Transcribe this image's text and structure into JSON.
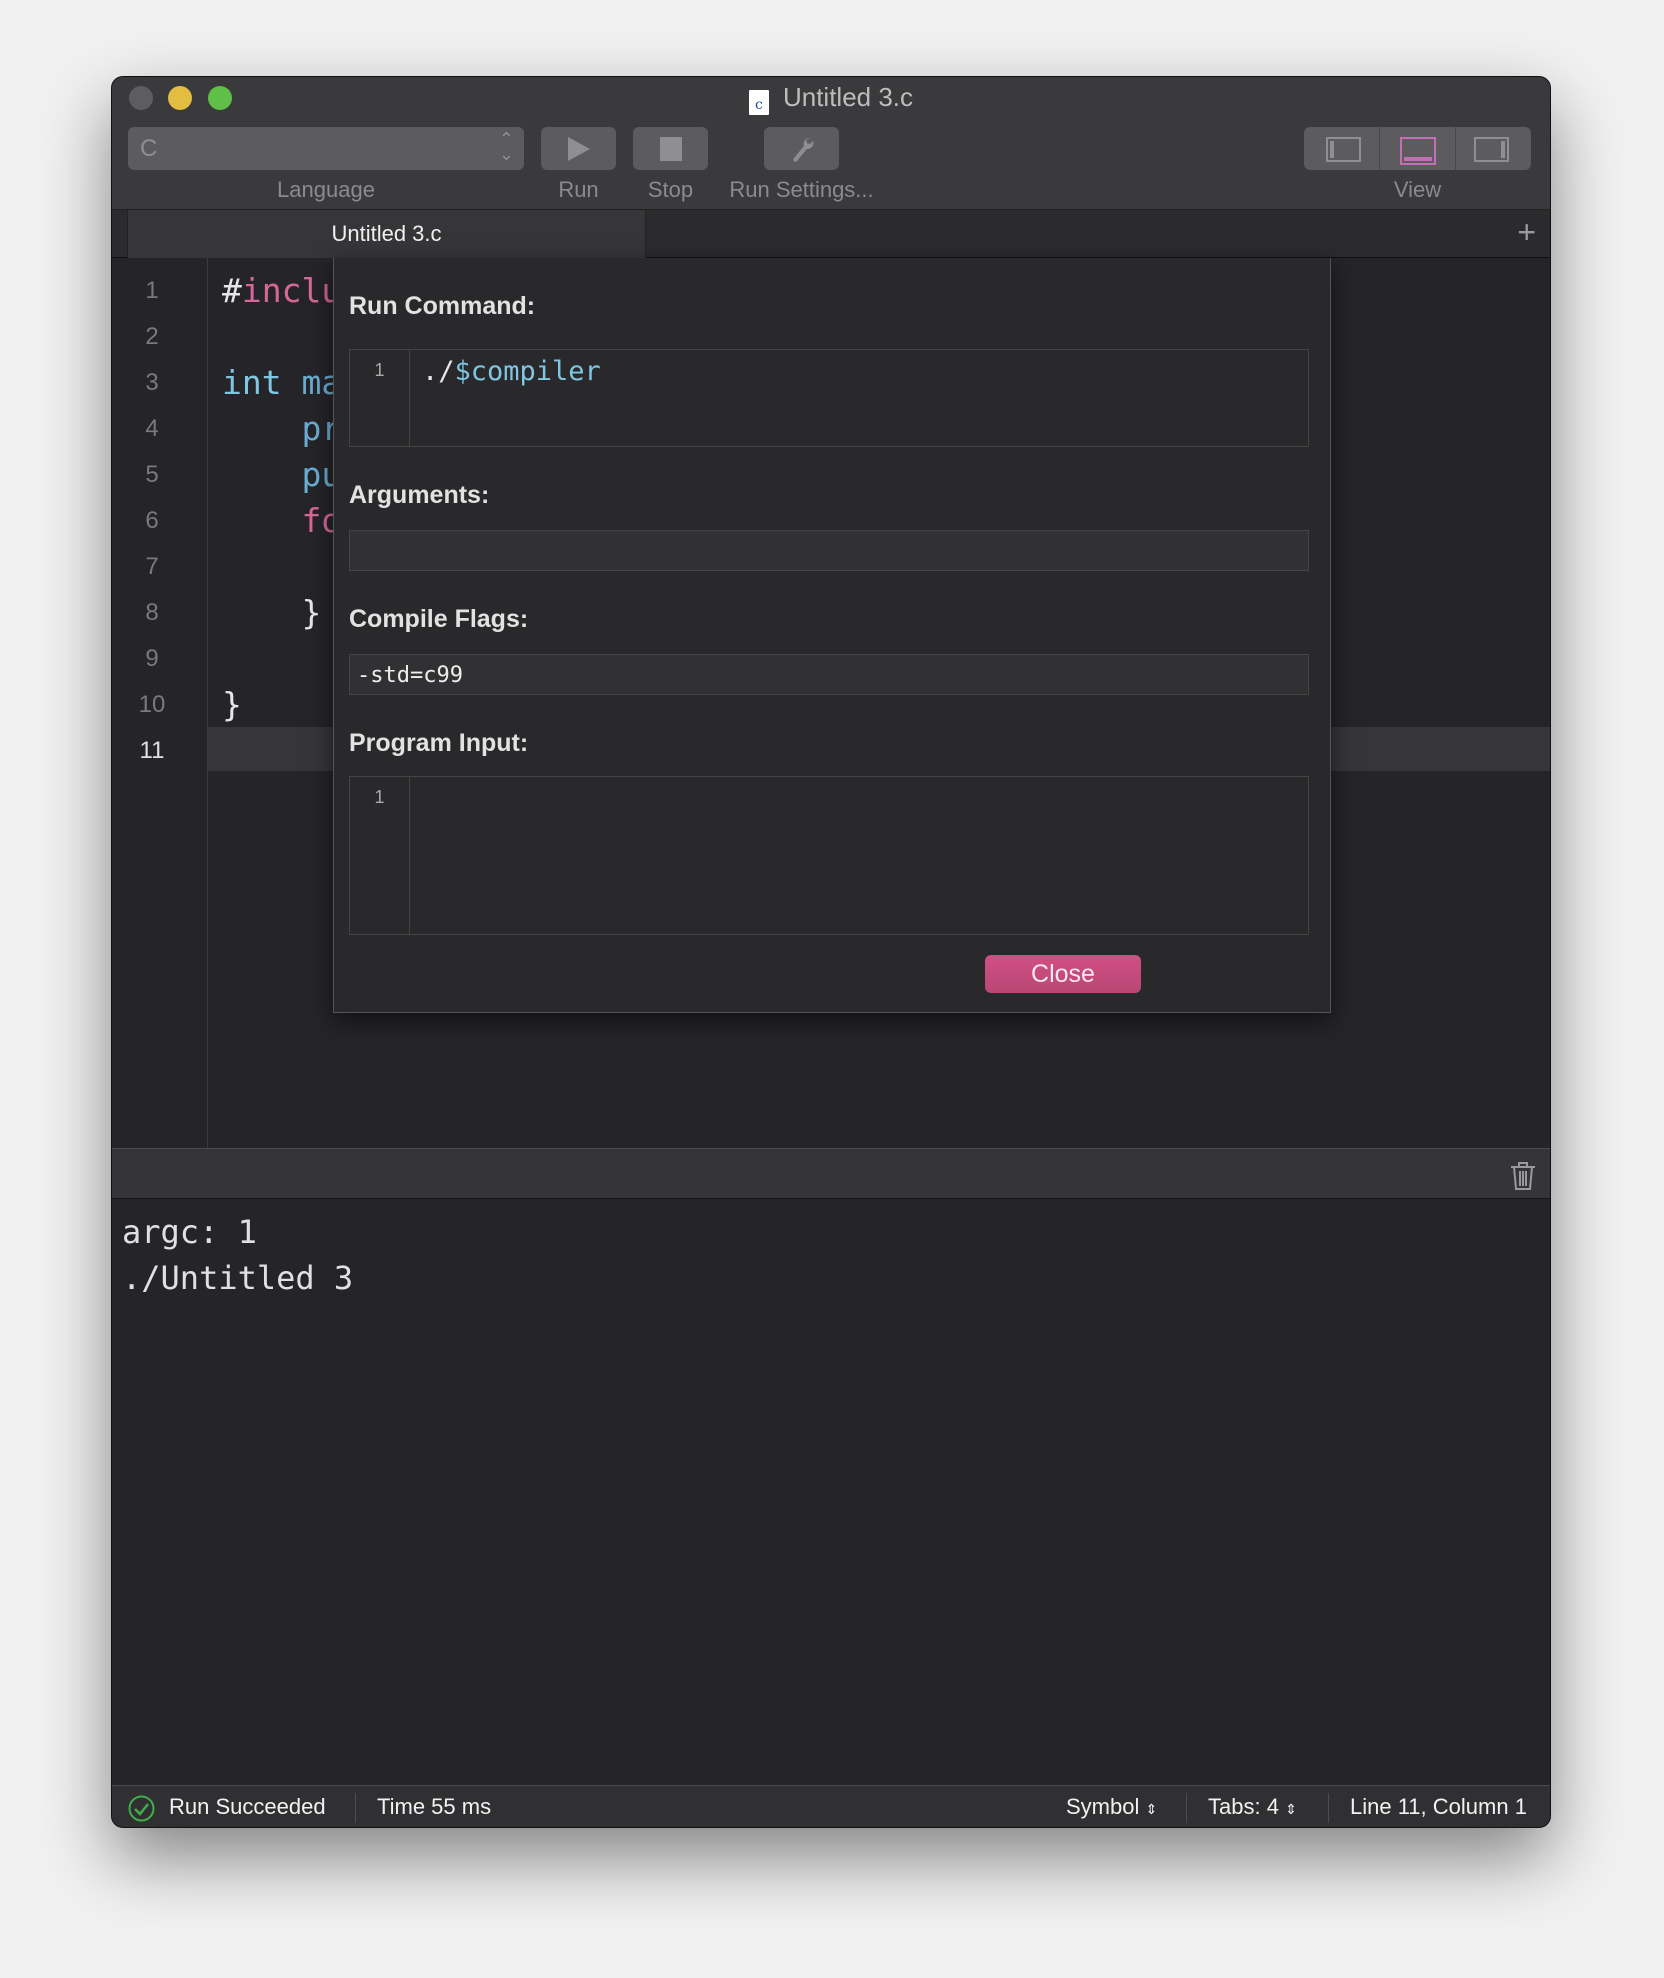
{
  "window": {
    "title": "Untitled 3.c",
    "doc_icon_letter": "c"
  },
  "toolbar": {
    "language_value": "C",
    "language_label": "Language",
    "run_label": "Run",
    "stop_label": "Stop",
    "run_settings_label": "Run Settings...",
    "view_label": "View",
    "accent": "#c36fb8"
  },
  "tabs": [
    {
      "label": "Untitled 3.c"
    }
  ],
  "editor": {
    "line_numbers": [
      "1",
      "2",
      "3",
      "4",
      "5",
      "6",
      "7",
      "8",
      "9",
      "10",
      "11"
    ],
    "visible_code": [
      {
        "parts": [
          {
            "t": "#",
            "c": "#e6e6e6"
          },
          {
            "t": "inclu",
            "c": "#d6679b"
          }
        ]
      },
      {
        "parts": []
      },
      {
        "parts": [
          {
            "t": "int ",
            "c": "#7fc6e3"
          },
          {
            "t": "ma",
            "c": "#6aaed4"
          }
        ]
      },
      {
        "parts": [
          {
            "t": "    pr",
            "c": "#6aaed4"
          }
        ]
      },
      {
        "parts": [
          {
            "t": "    pu",
            "c": "#6aaed4"
          }
        ]
      },
      {
        "parts": [
          {
            "t": "    fo",
            "c": "#d6679b"
          }
        ]
      },
      {
        "parts": []
      },
      {
        "parts": [
          {
            "t": "    }",
            "c": "#e6e6e6"
          }
        ]
      },
      {
        "parts": []
      },
      {
        "parts": [
          {
            "t": "}",
            "c": "#e6e6e6"
          }
        ]
      },
      {
        "parts": []
      }
    ]
  },
  "run_settings": {
    "run_command_label": "Run Command:",
    "run_command_line_number": "1",
    "run_command_prefix": "./",
    "run_command_variable": "$compiler",
    "arguments_label": "Arguments:",
    "arguments_value": "",
    "compile_flags_label": "Compile Flags:",
    "compile_flags_value": "-std=c99",
    "program_input_label": "Program Input:",
    "program_input_line_number": "1",
    "program_input_value": "",
    "close_label": "Close"
  },
  "console": {
    "lines": [
      "argc: 1",
      "./Untitled 3"
    ]
  },
  "status": {
    "run_status": "Run Succeeded",
    "time": "Time 55 ms",
    "symbol": "Symbol",
    "tabs": "Tabs: 4",
    "position": "Line 11, Column 1",
    "success_color": "#3fae4a"
  }
}
